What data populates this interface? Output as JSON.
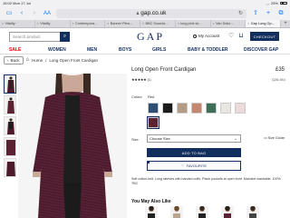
{
  "status": {
    "time": "15:02",
    "date": "Mon 17 Jul",
    "battery": "25%"
  },
  "safari": {
    "aa": "AA",
    "url": "gap.co.uk"
  },
  "tabs": [
    {
      "label": "Vitality"
    },
    {
      "label": "Vitality"
    },
    {
      "label": "Contempora..."
    },
    {
      "label": "Banner Plea..."
    },
    {
      "label": "BBC Sounds..."
    },
    {
      "label": "long pink sk..."
    },
    {
      "label": "Van Dolor..."
    },
    {
      "label": "Gap Long Op..."
    }
  ],
  "header": {
    "search_placeholder": "Search product",
    "logo": "GAP",
    "account": "My Account",
    "checkout": "CHECKOUT"
  },
  "nav": [
    "SALE",
    "WOMEN",
    "MEN",
    "BOYS",
    "GIRLS",
    "BABY & TODDLER",
    "DISCOVER GAP"
  ],
  "breadcrumb": {
    "back": "Back",
    "home": "Home",
    "current": "Long Open Front Cardigan"
  },
  "product": {
    "title": "Long Open Front Cardigan",
    "price": "£35",
    "rating_stars": "★★★★★",
    "rating_count": "(1)",
    "sku": "Q26-944",
    "color_label": "Colour",
    "color_value": "Red",
    "swatches": [
      "#2e4f73",
      "#1b1b1b",
      "#b39c83",
      "#c4866e",
      "#3e6e55",
      "#e9e6e2",
      "#ecd9d9",
      "#5b2233"
    ],
    "size_label": "Size",
    "size_value": "Choose Size",
    "size_guide": "Size Guide",
    "add_to_bag": "ADD TO BAG",
    "favourite": "FAVOURITE",
    "description": "Soft cotton-knit. Long sleeves with banded cuffs. Patch pockets at open front. Machine washable. 100% TBC"
  },
  "also_like": {
    "title": "You May Also Like"
  },
  "colors": {
    "navy": "#122e5c",
    "accent_red": "#e00000"
  }
}
